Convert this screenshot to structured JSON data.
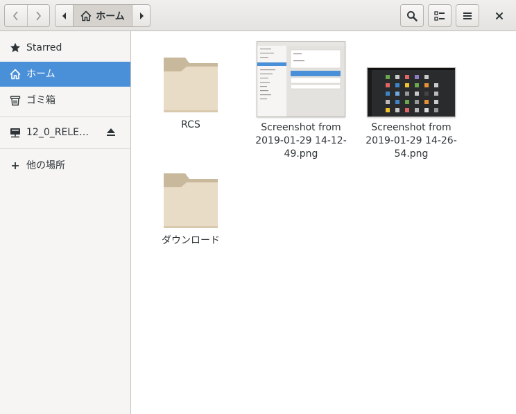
{
  "header": {
    "path_label": "ホーム",
    "icons": {
      "back": "go-previous-icon",
      "forward": "go-next-icon",
      "path_left": "pan-start-icon",
      "path_right": "pan-end-icon",
      "home": "home-icon",
      "search": "search-icon",
      "view": "view-list-icon",
      "menu": "menu-icon",
      "close": "close-icon"
    }
  },
  "sidebar": {
    "items": [
      {
        "label": "Starred",
        "icon": "star-icon"
      },
      {
        "label": "ホーム",
        "icon": "home-icon",
        "active": true
      },
      {
        "label": "ゴミ箱",
        "icon": "trash-icon"
      },
      {
        "label": "12_0_RELE…",
        "icon": "network-drive-icon"
      },
      {
        "label": "他の場所",
        "icon": "plus-icon"
      }
    ]
  },
  "files": [
    {
      "name": "RCS",
      "type": "folder"
    },
    {
      "name": "Screenshot from 2019-01-29 14-12-49.png",
      "type": "image"
    },
    {
      "name": "Screenshot from 2019-01-29 14-26-54.png",
      "type": "image"
    },
    {
      "name": "ダウンロード",
      "type": "folder"
    }
  ],
  "colors": {
    "accent": "#4a90d9",
    "folder": "#e9dcc6",
    "folder_tab": "#c8b89c"
  }
}
